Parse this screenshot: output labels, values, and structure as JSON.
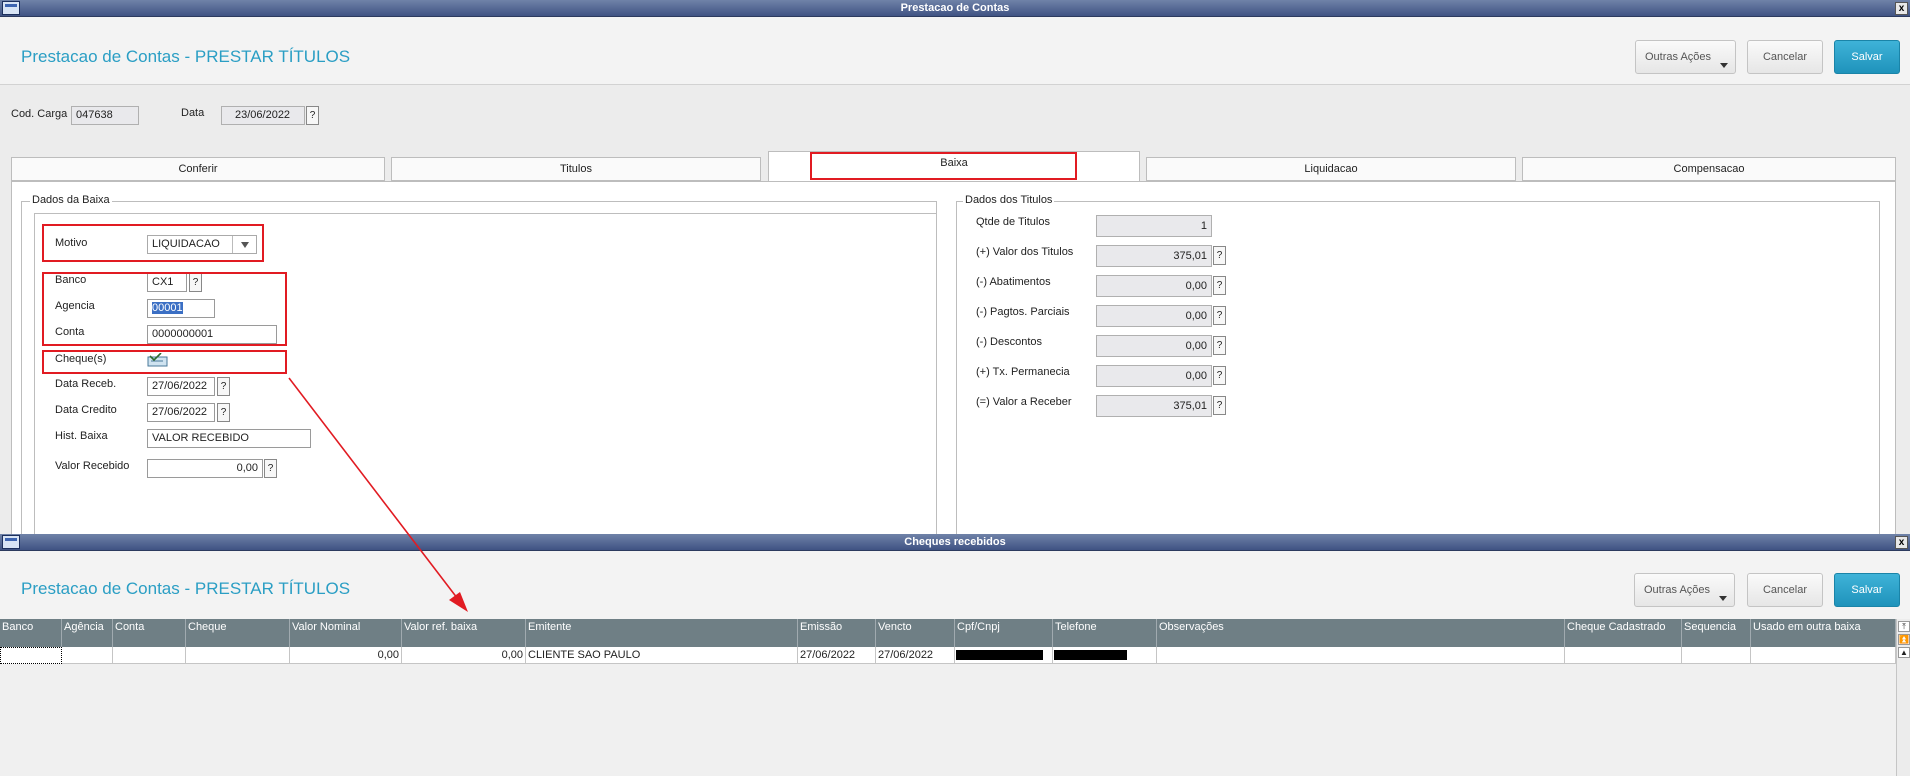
{
  "window1": {
    "title": "Prestacao de Contas",
    "close": "x",
    "page_title": "Prestacao de Contas - PRESTAR TÍTULOS",
    "buttons": {
      "outras": "Outras Ações",
      "cancelar": "Cancelar",
      "salvar": "Salvar"
    },
    "cod_carga_label": "Cod. Carga",
    "cod_carga_value": "047638",
    "data_label": "Data",
    "data_value": "23/06/2022",
    "help": "?",
    "tabs": [
      "Conferir",
      "Titulos",
      "Baixa",
      "Liquidacao",
      "Compensacao"
    ],
    "dados_baixa": {
      "legend": "Dados da Baixa",
      "motivo_label": "Motivo",
      "motivo_value": "LIQUIDACAO",
      "banco_label": "Banco",
      "banco_value": "CX1",
      "agencia_label": "Agencia",
      "agencia_value": "00001",
      "conta_label": "Conta",
      "conta_value": "0000000001",
      "cheques_label": "Cheque(s)",
      "data_receb_label": "Data Receb.",
      "data_receb_value": "27/06/2022",
      "data_credito_label": "Data Credito",
      "data_credito_value": "27/06/2022",
      "hist_label": "Hist. Baixa",
      "hist_value": "VALOR RECEBIDO",
      "valor_label": "Valor Recebido",
      "valor_value": "0,00"
    },
    "dados_titulos": {
      "legend": "Dados dos Titulos",
      "rows": [
        {
          "label": "Qtde de Titulos",
          "value": "1"
        },
        {
          "label": "(+) Valor dos Titulos",
          "value": "375,01"
        },
        {
          "label": "(-) Abatimentos",
          "value": "0,00"
        },
        {
          "label": "(-) Pagtos. Parciais",
          "value": "0,00"
        },
        {
          "label": "(-) Descontos",
          "value": "0,00"
        },
        {
          "label": "(+) Tx. Permanecia",
          "value": "0,00"
        },
        {
          "label": "(=) Valor a Receber",
          "value": "375,01"
        }
      ]
    }
  },
  "window2": {
    "title": "Cheques recebidos",
    "close": "x",
    "page_title": "Prestacao de Contas - PRESTAR TÍTULOS",
    "buttons": {
      "outras": "Outras Ações",
      "cancelar": "Cancelar",
      "salvar": "Salvar"
    },
    "columns": [
      "Banco",
      "Agência",
      "Conta",
      "Cheque",
      "Valor Nominal",
      "Valor ref. baixa",
      "Emitente",
      "Emissão",
      "Vencto",
      "Cpf/Cnpj",
      "Telefone",
      "Observações",
      "Cheque Cadastrado",
      "Sequencia",
      "Usado em outra baixa"
    ],
    "row": [
      "",
      "",
      "",
      "",
      "0,00",
      "0,00",
      "CLIENTE SAO PAULO",
      "27/06/2022",
      "27/06/2022",
      "",
      "",
      "",
      "",
      "",
      ""
    ]
  },
  "colors": {
    "accent": "#2a9ec4",
    "primary_button": "#2aa6cf",
    "annotation": "#e11b22",
    "grid_header": "#6f7f85"
  }
}
